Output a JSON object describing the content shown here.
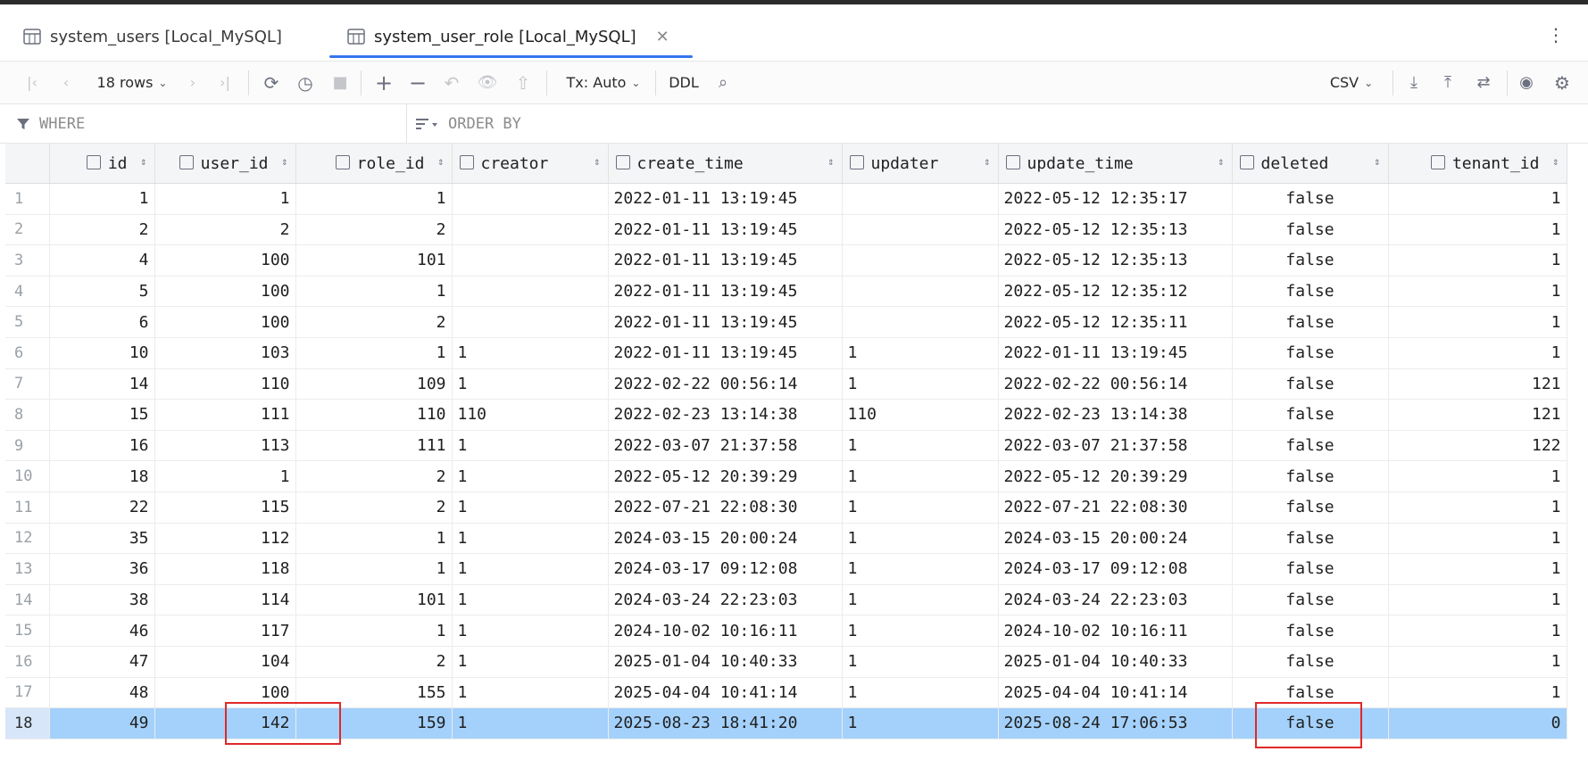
{
  "tabs": [
    {
      "label": "system_users [Local_MySQL]",
      "active": false
    },
    {
      "label": "system_user_role [Local_MySQL]",
      "active": true
    }
  ],
  "toolbar": {
    "rows_label": "18 rows",
    "tx_label": "Tx: Auto",
    "ddl_label": "DDL",
    "export_format": "CSV"
  },
  "filter": {
    "where_placeholder": "WHERE",
    "orderby_placeholder": "ORDER BY"
  },
  "table": {
    "columns": [
      "id",
      "user_id",
      "role_id",
      "creator",
      "create_time",
      "updater",
      "update_time",
      "deleted",
      "tenant_id"
    ],
    "rows": [
      [
        "1",
        "1",
        "1",
        "",
        "2022-01-11 13:19:45",
        "",
        "2022-05-12 12:35:17",
        "false",
        "1"
      ],
      [
        "2",
        "2",
        "2",
        "",
        "2022-01-11 13:19:45",
        "",
        "2022-05-12 12:35:13",
        "false",
        "1"
      ],
      [
        "4",
        "100",
        "101",
        "",
        "2022-01-11 13:19:45",
        "",
        "2022-05-12 12:35:13",
        "false",
        "1"
      ],
      [
        "5",
        "100",
        "1",
        "",
        "2022-01-11 13:19:45",
        "",
        "2022-05-12 12:35:12",
        "false",
        "1"
      ],
      [
        "6",
        "100",
        "2",
        "",
        "2022-01-11 13:19:45",
        "",
        "2022-05-12 12:35:11",
        "false",
        "1"
      ],
      [
        "10",
        "103",
        "1",
        "1",
        "2022-01-11 13:19:45",
        "1",
        "2022-01-11 13:19:45",
        "false",
        "1"
      ],
      [
        "14",
        "110",
        "109",
        "1",
        "2022-02-22 00:56:14",
        "1",
        "2022-02-22 00:56:14",
        "false",
        "121"
      ],
      [
        "15",
        "111",
        "110",
        "110",
        "2022-02-23 13:14:38",
        "110",
        "2022-02-23 13:14:38",
        "false",
        "121"
      ],
      [
        "16",
        "113",
        "111",
        "1",
        "2022-03-07 21:37:58",
        "1",
        "2022-03-07 21:37:58",
        "false",
        "122"
      ],
      [
        "18",
        "1",
        "2",
        "1",
        "2022-05-12 20:39:29",
        "1",
        "2022-05-12 20:39:29",
        "false",
        "1"
      ],
      [
        "22",
        "115",
        "2",
        "1",
        "2022-07-21 22:08:30",
        "1",
        "2022-07-21 22:08:30",
        "false",
        "1"
      ],
      [
        "35",
        "112",
        "1",
        "1",
        "2024-03-15 20:00:24",
        "1",
        "2024-03-15 20:00:24",
        "false",
        "1"
      ],
      [
        "36",
        "118",
        "1",
        "1",
        "2024-03-17 09:12:08",
        "1",
        "2024-03-17 09:12:08",
        "false",
        "1"
      ],
      [
        "38",
        "114",
        "101",
        "1",
        "2024-03-24 22:23:03",
        "1",
        "2024-03-24 22:23:03",
        "false",
        "1"
      ],
      [
        "46",
        "117",
        "1",
        "1",
        "2024-10-02 10:16:11",
        "1",
        "2024-10-02 10:16:11",
        "false",
        "1"
      ],
      [
        "47",
        "104",
        "2",
        "1",
        "2025-01-04 10:40:33",
        "1",
        "2025-01-04 10:40:33",
        "false",
        "1"
      ],
      [
        "48",
        "100",
        "155",
        "1",
        "2025-04-04 10:41:14",
        "1",
        "2025-04-04 10:41:14",
        "false",
        "1"
      ],
      [
        "49",
        "142",
        "159",
        "1",
        "2025-08-23 18:41:20",
        "1",
        "2025-08-24 17:06:53",
        "false",
        "0"
      ]
    ],
    "selected_row": 18
  },
  "colors": {
    "accent": "#3574f0",
    "selection": "#a4d1fb",
    "highlight_box": "#e02828"
  }
}
